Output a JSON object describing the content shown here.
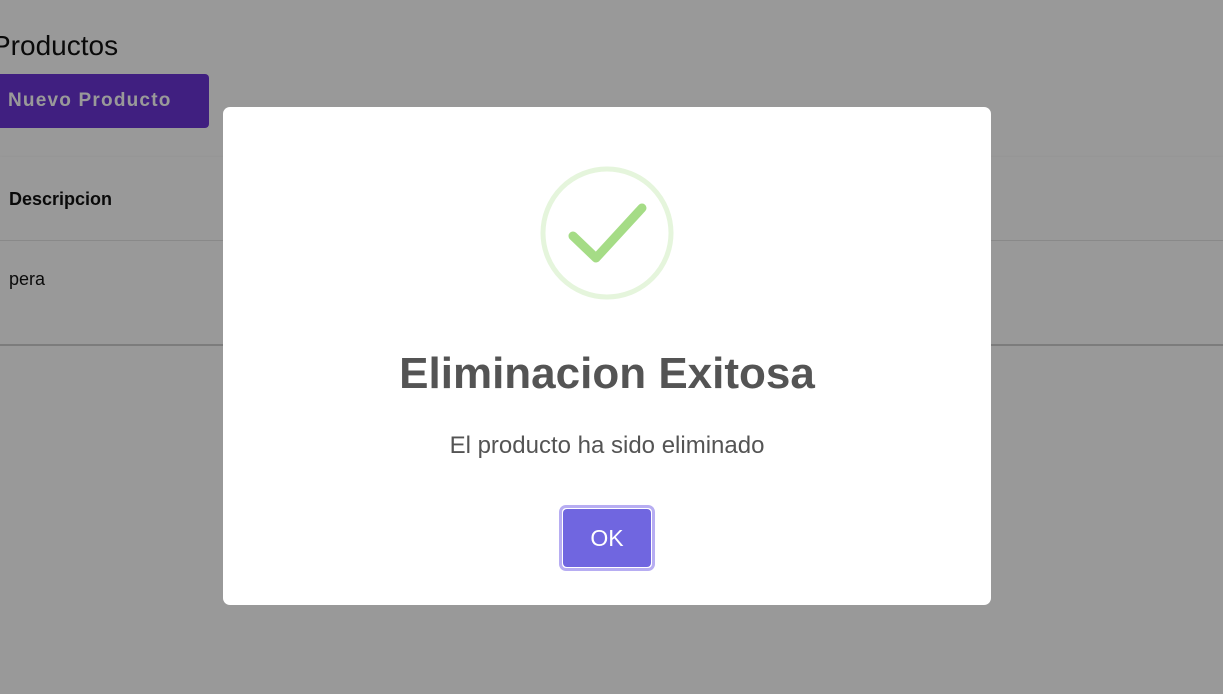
{
  "page": {
    "title": "Productos",
    "new_button_label": "Nuevo Producto",
    "table": {
      "columns": [
        "Descripcion"
      ],
      "rows": [
        [
          "pera"
        ]
      ]
    }
  },
  "dialog": {
    "icon": "success-check-icon",
    "title": "Eliminacion Exitosa",
    "message": "El producto ha sido eliminado",
    "confirm_label": "OK"
  },
  "colors": {
    "primary": "#6c35d6",
    "confirm": "#7066e0",
    "success": "#a5dc86",
    "text": "#545454"
  }
}
